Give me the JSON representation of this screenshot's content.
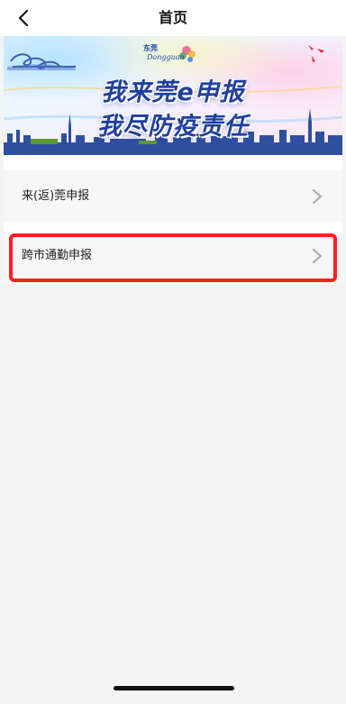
{
  "header": {
    "title": "首页",
    "back_icon": "chevron-left-icon"
  },
  "banner": {
    "logo_cn": "东莞",
    "logo_en": "Dongguan",
    "line1": "我来莞e申报",
    "line2": "我尽防疫责任"
  },
  "menu": {
    "items": [
      {
        "label": "来(返)莞申报",
        "icon": "chevron-right-icon",
        "highlighted": false
      },
      {
        "label": "跨市通勤申报",
        "icon": "chevron-right-icon",
        "highlighted": true
      }
    ]
  },
  "colors": {
    "highlight_border": "#ff1f1f",
    "banner_text": "#1f3f9e",
    "background": "#f4f4f4"
  }
}
